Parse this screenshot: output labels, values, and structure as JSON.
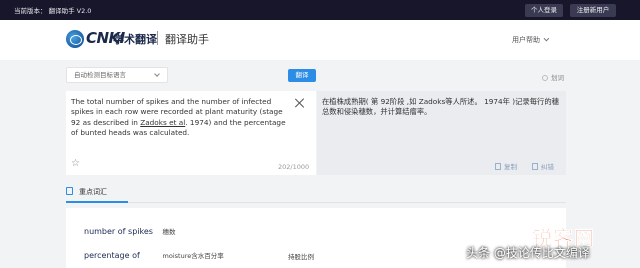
{
  "topbar": {
    "version": "当前版本： 翻译助手 V2.0",
    "personal_center": "个人登录",
    "register": "注册新用户"
  },
  "header": {
    "logo_brand": "CNKI",
    "logo_name": "学术翻译",
    "logo_sub": "翻译助手",
    "help_menu": "用户帮助"
  },
  "controls": {
    "source_language": "自动检测目标语言",
    "translate_button": "翻译",
    "divide_toggle": "划词"
  },
  "source": {
    "text_before_link": "The total number of spikes and the number of infected spikes in each row were recorded at plant maturity (stage 92 as described in ",
    "link_text": "Zadoks et al",
    "text_after_link": ". 1974) and the percentage of bunted heads was calculated.",
    "char_count": "202/1000"
  },
  "result": {
    "text": "在植株成熟期( 第 92阶段 ,如 Zadoks等人所述。 1974年 )记录每行的穗总数和侵染穗数，并计算结瘤率。",
    "copy_label": "复制",
    "correct_label": "纠错"
  },
  "keywords": {
    "title": "重点词汇",
    "rows": [
      {
        "term": "number of spikes",
        "definition": "穗数",
        "definition2": ""
      },
      {
        "term": "percentage of",
        "definition": "moisture含水百分率",
        "definition2": "持股比例"
      }
    ]
  },
  "watermark": {
    "brand": "锐客网",
    "line": "头条 @技论传比文编译"
  },
  "colors": {
    "topbar_bg": "#17162b",
    "accent": "#2c8de6",
    "page_bg": "#f2f3f5"
  }
}
